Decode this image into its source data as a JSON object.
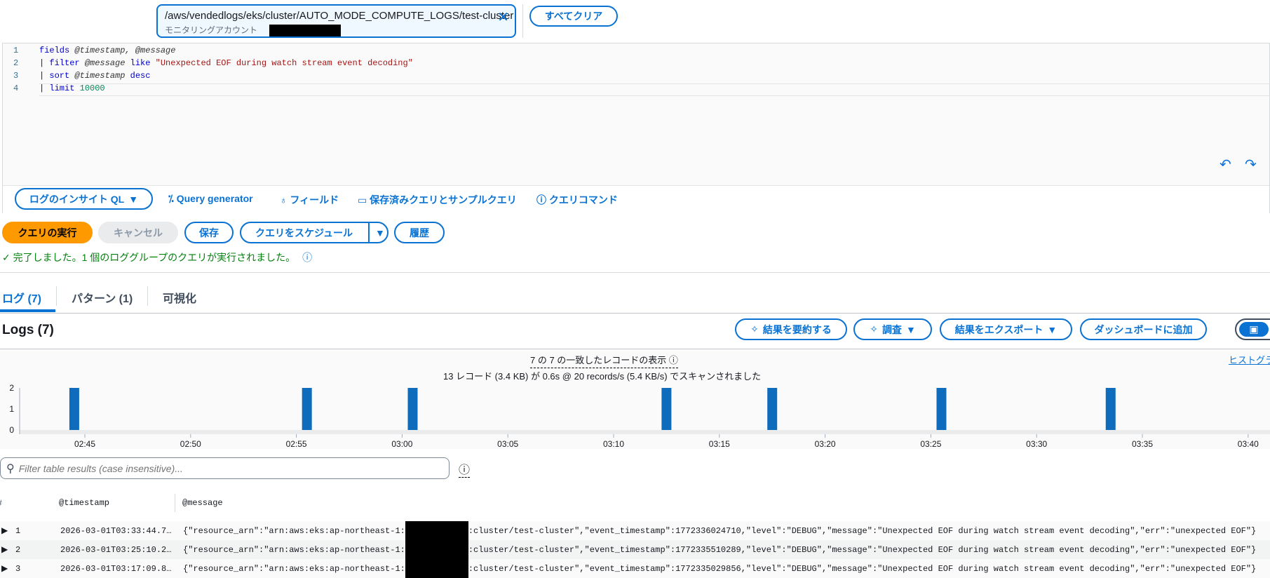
{
  "log_group": {
    "name": "/aws/vendedlogs/eks/cluster/AUTO_MODE_COMPUTE_LOGS/test-cluster",
    "account_label": "モニタリングアカウント",
    "clear_all": "すべてクリア"
  },
  "editor": {
    "lines": [
      "1",
      "2",
      "3",
      "4"
    ],
    "l1": {
      "kw": "fields",
      "rest": " @timestamp, @message"
    },
    "l2": {
      "pipe": "| ",
      "kw": "filter",
      "var": " @message ",
      "kw2": "like",
      "str": " \"Unexpected EOF during watch stream event decoding\""
    },
    "l3": {
      "pipe": "| ",
      "kw": "sort",
      "var": " @timestamp ",
      "kw2": "desc"
    },
    "l4": {
      "pipe": "| ",
      "kw": "limit",
      "num": " 10000"
    }
  },
  "query_toolbar": {
    "language": "ログのインサイト QL",
    "query_generator": "Query generator",
    "fields": "フィールド",
    "saved": "保存済みクエリとサンプルクエリ",
    "commands": "クエリコマンド"
  },
  "actions": {
    "run": "クエリの実行",
    "cancel": "キャンセル",
    "save": "保存",
    "schedule": "クエリをスケジュール",
    "history": "履歴"
  },
  "status": "完了しました。1 個のロググループのクエリが実行されました。",
  "tabs": [
    {
      "label": "ログ (7)"
    },
    {
      "label": "パターン (1)"
    },
    {
      "label": "可視化"
    }
  ],
  "logs": {
    "title": "Logs (7)",
    "summarize": "結果を要約する",
    "investigate": "調査",
    "export": "結果をエクスポート",
    "dashboard": "ダッシュボードに追加"
  },
  "summary": {
    "matched": "7 の 7 の一致したレコードの表示",
    "scanned": "13 レコード (3.4 KB) が 0.6s @ 20 records/s (5.4 KB/s) でスキャンされました",
    "histogram_link": "ヒストグラ"
  },
  "chart_data": {
    "type": "bar",
    "x_ticks": [
      "02:45",
      "02:50",
      "02:55",
      "03:00",
      "03:05",
      "03:10",
      "03:15",
      "03:20",
      "03:25",
      "03:30",
      "03:35",
      "03:40"
    ],
    "y_ticks": [
      "0",
      "1",
      "2"
    ],
    "ylim": [
      0,
      2
    ],
    "xlim_minutes_after_0200": [
      41,
      101
    ],
    "bins": [
      {
        "minute": 44,
        "value": 2
      },
      {
        "minute": 55,
        "value": 2
      },
      {
        "minute": 60,
        "value": 2
      },
      {
        "minute": 72,
        "value": 2
      },
      {
        "minute": 77,
        "value": 2
      },
      {
        "minute": 85,
        "value": 2
      },
      {
        "minute": 93,
        "value": 2
      }
    ],
    "color": "#0f6cbd"
  },
  "filter": {
    "placeholder": "Filter table results (case insensitive)..."
  },
  "table": {
    "headers": [
      "#",
      "@timestamp",
      "@message"
    ],
    "rows": [
      {
        "n": "1",
        "ts": "2026-03-01T03:33:44.7…",
        "pre": "{\"resource_arn\":\"arn:aws:eks:ap-northeast-1:",
        "post": ":cluster/test-cluster\",\"event_timestamp\":1772336024710,\"level\":\"DEBUG\",\"message\":\"Unexpected EOF during watch stream event decoding\",\"err\":\"unexpected EOF\"}"
      },
      {
        "n": "2",
        "ts": "2026-03-01T03:25:10.2…",
        "pre": "{\"resource_arn\":\"arn:aws:eks:ap-northeast-1:",
        "post": ":cluster/test-cluster\",\"event_timestamp\":1772335510289,\"level\":\"DEBUG\",\"message\":\"Unexpected EOF during watch stream event decoding\",\"err\":\"unexpected EOF\"}"
      },
      {
        "n": "3",
        "ts": "2026-03-01T03:17:09.8…",
        "pre": "{\"resource_arn\":\"arn:aws:eks:ap-northeast-1:",
        "post": ":cluster/test-cluster\",\"event_timestamp\":1772335029856,\"level\":\"DEBUG\",\"message\":\"Unexpected EOF during watch stream event decoding\",\"err\":\"unexpected EOF\"}"
      }
    ]
  }
}
